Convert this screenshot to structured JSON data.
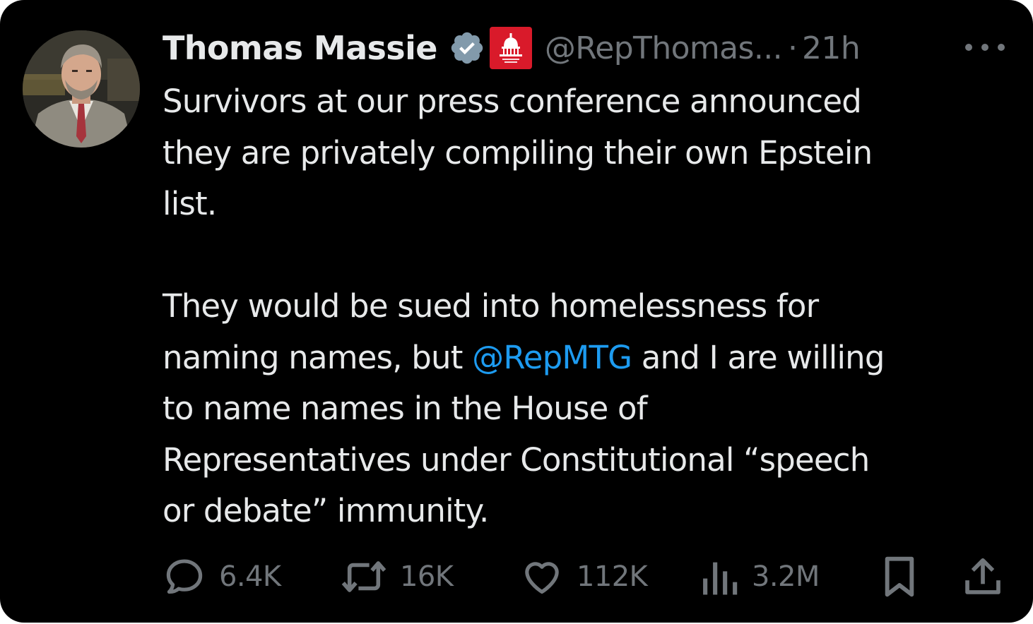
{
  "author": {
    "display_name": "Thomas Massie",
    "handle": "@RepThomas...",
    "separator": "·",
    "timestamp": "21h",
    "verified": true,
    "affiliation_badge": "capitol-dome-gop-badge"
  },
  "tweet": {
    "line1": "Survivors at our press conference announced",
    "line2": "they are privately compiling their own Epstein",
    "line3": "list.",
    "line4": "They would be sued into homelessness for",
    "line5_prefix": "naming names, but ",
    "line5_mention": "@RepMTG",
    "line5_suffix": " and I are willing",
    "line6": "to name names in the House of",
    "line7": "Representatives under Constitutional “speech",
    "line8": "or debate” immunity."
  },
  "metrics": {
    "replies": "6.4K",
    "reposts": "16K",
    "likes": "112K",
    "views": "3.2M"
  },
  "icons": {
    "reply": "speech-bubble-icon",
    "repost": "repost-arrows-icon",
    "like": "heart-icon",
    "views": "bar-chart-icon",
    "bookmark": "bookmark-icon",
    "share": "share-upload-icon",
    "more": "more-dots-icon",
    "verified": "verified-check-icon"
  },
  "colors": {
    "background": "#000000",
    "text_primary": "#e7e9ea",
    "text_secondary": "#71767b",
    "mention": "#1d9bf0",
    "verified_badge": "#829aab",
    "affiliation_badge": "#d91a2a"
  }
}
